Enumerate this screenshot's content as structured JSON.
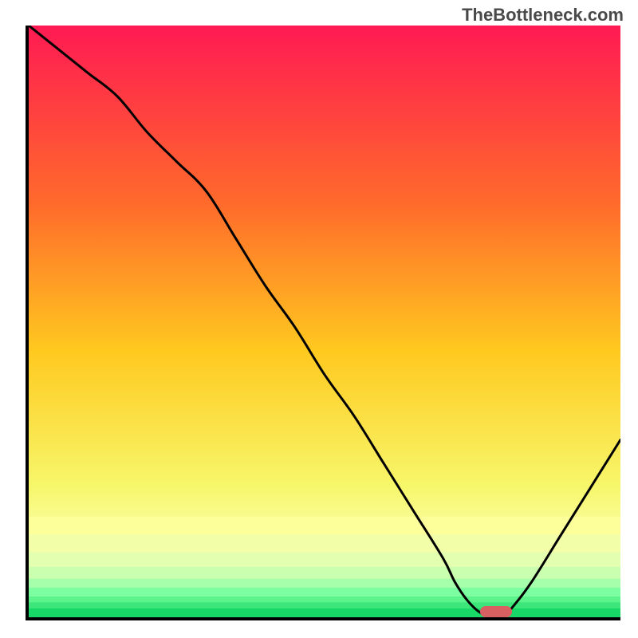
{
  "watermark": "TheBottleneck.com",
  "chart_data": {
    "type": "line",
    "title": "",
    "xlabel": "",
    "ylabel": "",
    "xlim": [
      0,
      100
    ],
    "ylim": [
      0,
      100
    ],
    "x": [
      0,
      5,
      10,
      15,
      20,
      25,
      30,
      35,
      40,
      45,
      50,
      55,
      60,
      65,
      70,
      72,
      74,
      76,
      78,
      80,
      82,
      85,
      90,
      95,
      100
    ],
    "values": [
      100,
      96,
      92,
      88,
      82,
      77,
      72,
      64,
      56,
      49,
      41,
      34,
      26,
      18,
      10,
      6,
      3,
      1,
      0,
      0,
      2,
      6,
      14,
      22,
      30
    ],
    "gradient_stops": [
      {
        "offset": 0.0,
        "color": "#ff1a53"
      },
      {
        "offset": 0.3,
        "color": "#ff6a2b"
      },
      {
        "offset": 0.55,
        "color": "#ffc91f"
      },
      {
        "offset": 0.78,
        "color": "#f7f76b"
      },
      {
        "offset": 0.88,
        "color": "#f9ffb0"
      },
      {
        "offset": 0.93,
        "color": "#c8ff9a"
      },
      {
        "offset": 0.97,
        "color": "#5fff7a"
      },
      {
        "offset": 1.0,
        "color": "#18e05e"
      }
    ],
    "marker": {
      "x": 79,
      "shape": "pill",
      "color": "#d96060"
    },
    "bands": [
      {
        "y_frac": 0.86,
        "color": "#fdff9a"
      },
      {
        "y_frac": 0.89,
        "color": "#f3ffa8"
      },
      {
        "y_frac": 0.915,
        "color": "#e3ffb0"
      },
      {
        "y_frac": 0.935,
        "color": "#c9ffaf"
      },
      {
        "y_frac": 0.95,
        "color": "#a6ffab"
      },
      {
        "y_frac": 0.965,
        "color": "#7cffa0"
      },
      {
        "y_frac": 0.975,
        "color": "#5cf28c"
      },
      {
        "y_frac": 0.985,
        "color": "#3de67a"
      },
      {
        "y_frac": 1.0,
        "color": "#18d868"
      }
    ]
  }
}
